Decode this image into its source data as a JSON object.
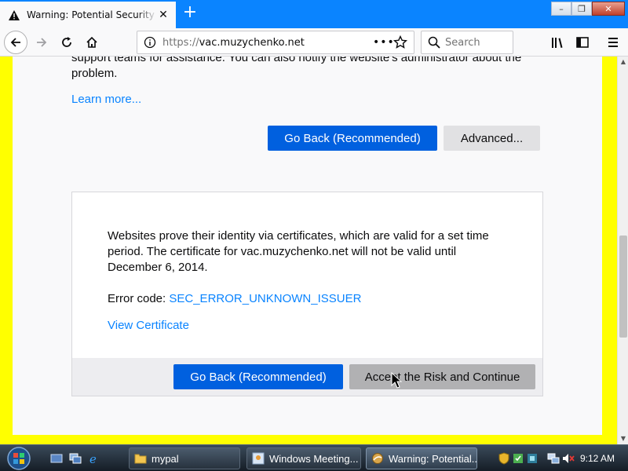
{
  "tab": {
    "title": "Warning: Potential Security Risk Ahead",
    "new_tab_symbol": "+",
    "close_symbol": "✕"
  },
  "window_controls": {
    "minimize": "–",
    "maximize": "❐",
    "close": "✕"
  },
  "nav": {
    "url_protocol": "https://",
    "url_host": "vac.muzychenko.net",
    "search_placeholder": "Search"
  },
  "page": {
    "intro_text": "support teams for assistance. You can also notify the website's administrator about the problem.",
    "learn_more": "Learn more...",
    "go_back_label": "Go Back (Recommended)",
    "advanced_label": "Advanced..."
  },
  "advanced_panel": {
    "cert_text": "Websites prove their identity via certificates, which are valid for a set time period. The certificate for vac.muzychenko.net will not be valid until December 6, 2014.",
    "error_code_label": "Error code: ",
    "error_code": "SEC_ERROR_UNKNOWN_ISSUER",
    "view_certificate": "View Certificate",
    "go_back_label": "Go Back (Recommended)",
    "accept_label": "Accept the Risk and Continue"
  },
  "taskbar": {
    "tasks": [
      {
        "label": "mypal",
        "icon": "folder-icon"
      },
      {
        "label": "Windows Meeting...",
        "icon": "meeting-icon"
      },
      {
        "label": "Warning: Potential...",
        "icon": "browser-icon"
      }
    ],
    "clock": "9:12 AM"
  },
  "colors": {
    "accent": "#0a84ff",
    "primary_button": "#0060df",
    "page_border": "#ffff00"
  }
}
